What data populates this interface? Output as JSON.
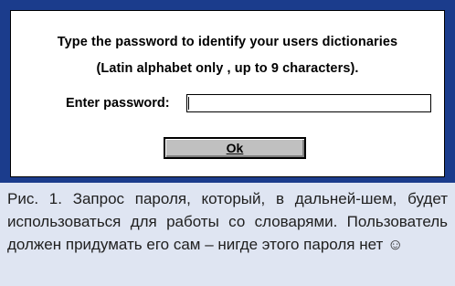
{
  "dialog": {
    "message_line1": "Type the password to identify your users dictionaries",
    "message_line2": "(Latin alphabet only , up to 9 characters).",
    "password_label": "Enter password:",
    "password_value": "",
    "ok_label": "Ok"
  },
  "caption": {
    "text": "Рис. 1. Запрос пароля, который, в дальней-шем, будет использоваться для работы со словарями. Пользователь должен придумать его сам – нигде этого пароля нет ☺"
  },
  "colors": {
    "frame": "#1b3c8c",
    "dialog_bg": "#ffffff",
    "button_face": "#c0c0c0",
    "caption_bg": "#dfe5f2"
  }
}
